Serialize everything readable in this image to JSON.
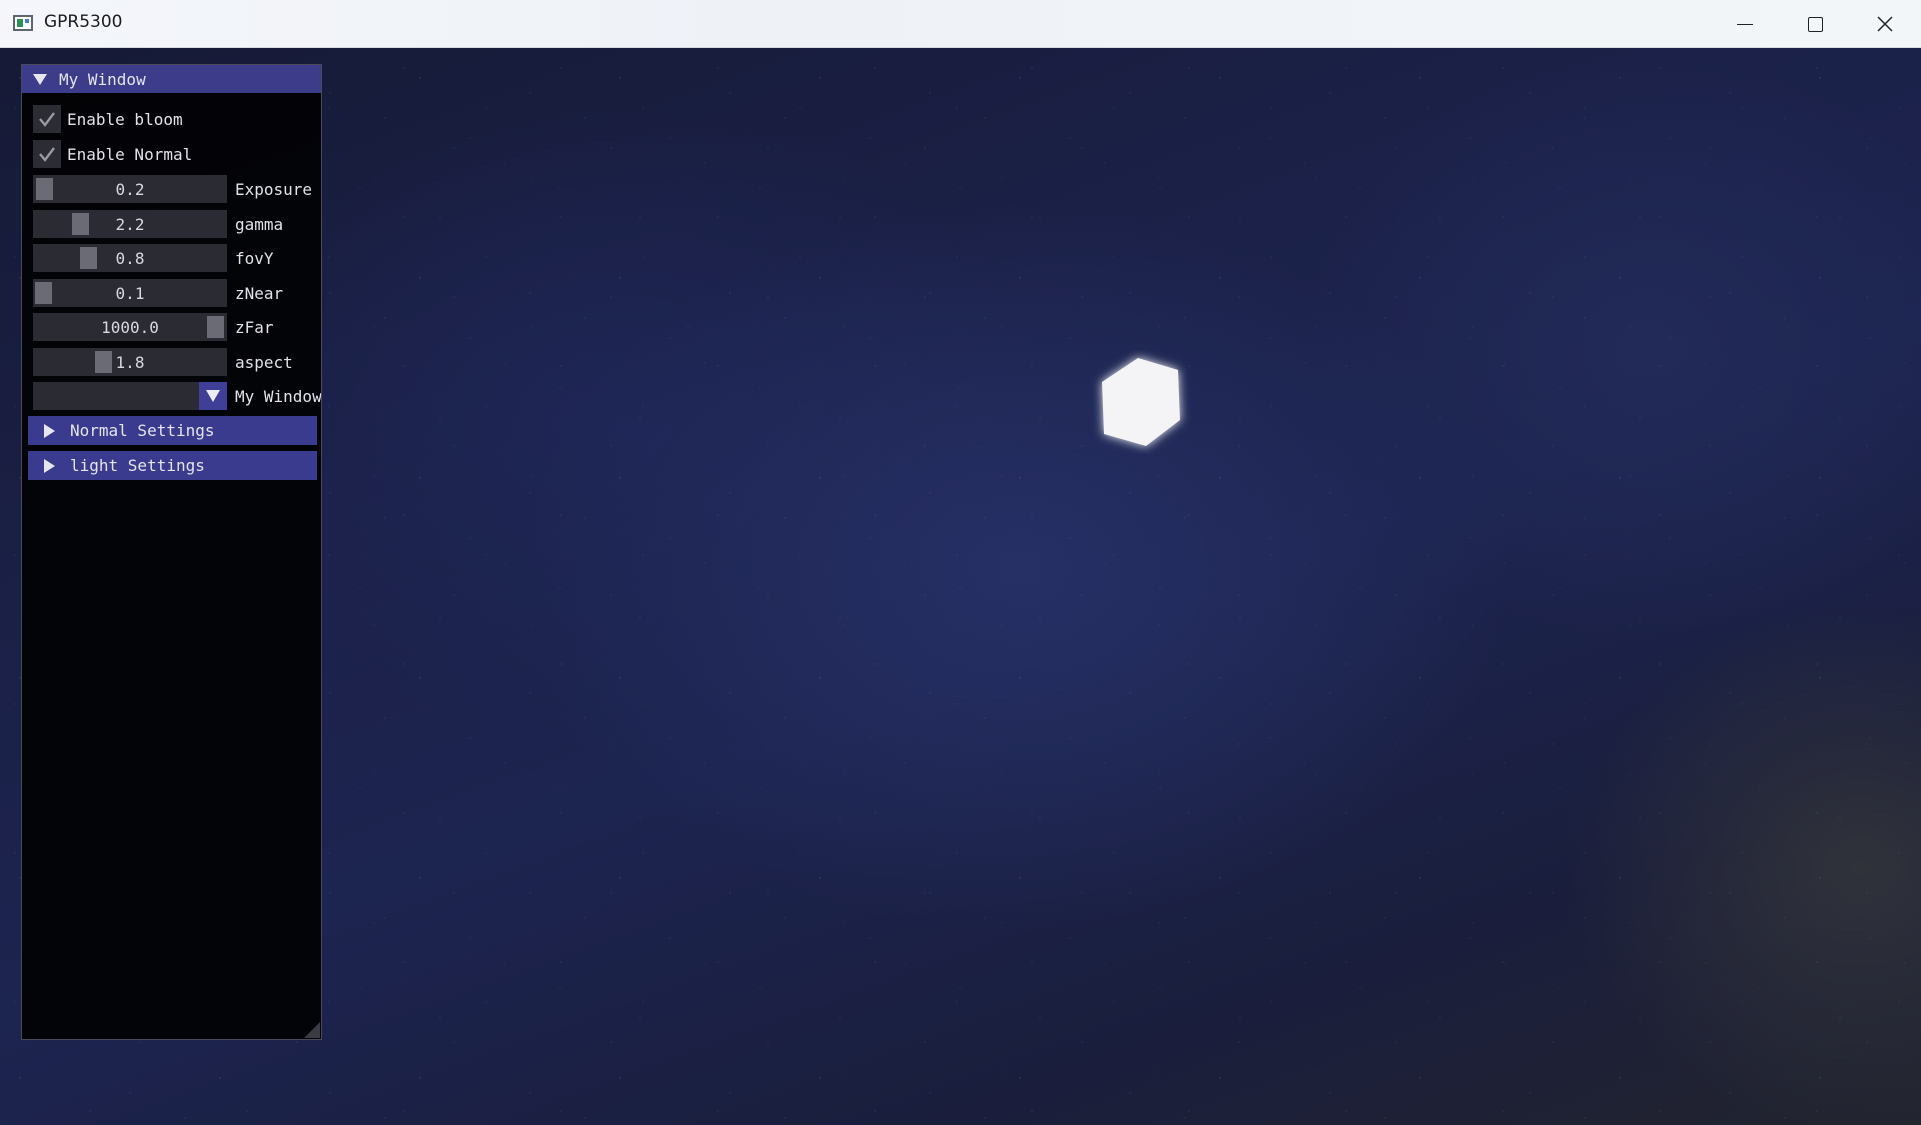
{
  "window": {
    "title": "GPR5300",
    "controls": {
      "minimize": "minimize",
      "maximize": "maximize",
      "close": "close"
    }
  },
  "imgui": {
    "title": "My Window",
    "checkboxes": [
      {
        "label": "Enable bloom",
        "checked": true
      },
      {
        "label": "Enable Normal",
        "checked": true
      }
    ],
    "sliders": [
      {
        "label": "Exposure",
        "value": "0.2"
      },
      {
        "label": "gamma",
        "value": "2.2"
      },
      {
        "label": "fovY",
        "value": "0.8"
      },
      {
        "label": "zNear",
        "value": "0.1"
      },
      {
        "label": "zFar",
        "value": "1000.0"
      },
      {
        "label": "aspect",
        "value": "1.8"
      }
    ],
    "combo": {
      "label": "My Window",
      "value": ""
    },
    "headers": [
      {
        "label": "Normal Settings",
        "collapsed": true
      },
      {
        "label": "light Settings",
        "collapsed": true
      }
    ]
  },
  "colors": {
    "imgui_title": "#3c3c8a",
    "imgui_header": "#3a3a8e",
    "imgui_bg": "#030305",
    "viewport_bg": "#1c2450"
  }
}
